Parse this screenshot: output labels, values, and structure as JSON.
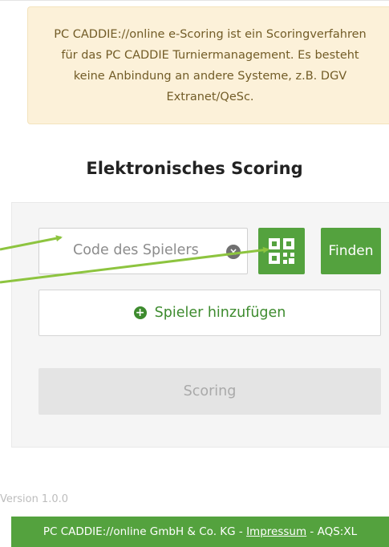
{
  "notice": {
    "lines": [
      "PC CADDIE://online e-Scoring ist ein Scoringverfahren",
      "für das PC CADDIE Turniermanagement. Es besteht",
      "keine Anbindung an andere Systeme, z.B. DGV",
      "Extranet/QeSc."
    ]
  },
  "title": "Elektronisches Scoring",
  "search": {
    "placeholder": "Code des Spielers",
    "clear_icon": "clear-circle-icon",
    "qr_icon": "qr-code-icon",
    "find_label": "Finden"
  },
  "add_player": {
    "label": "Spieler hinzufügen",
    "icon": "plus-circle-icon"
  },
  "scoring": {
    "label": "Scoring"
  },
  "version": "Version 1.0.0",
  "footer": {
    "company": "PC CADDIE://online GmbH & Co. KG",
    "sep1": " - ",
    "impressum": "Impressum",
    "sep2": " - ",
    "suffix": "AQS:XL"
  },
  "colors": {
    "brand_green": "#54a23e",
    "notice_bg": "#fcf1d9",
    "notice_text": "#725c27",
    "annotation_arrow": "#8dc43f"
  }
}
